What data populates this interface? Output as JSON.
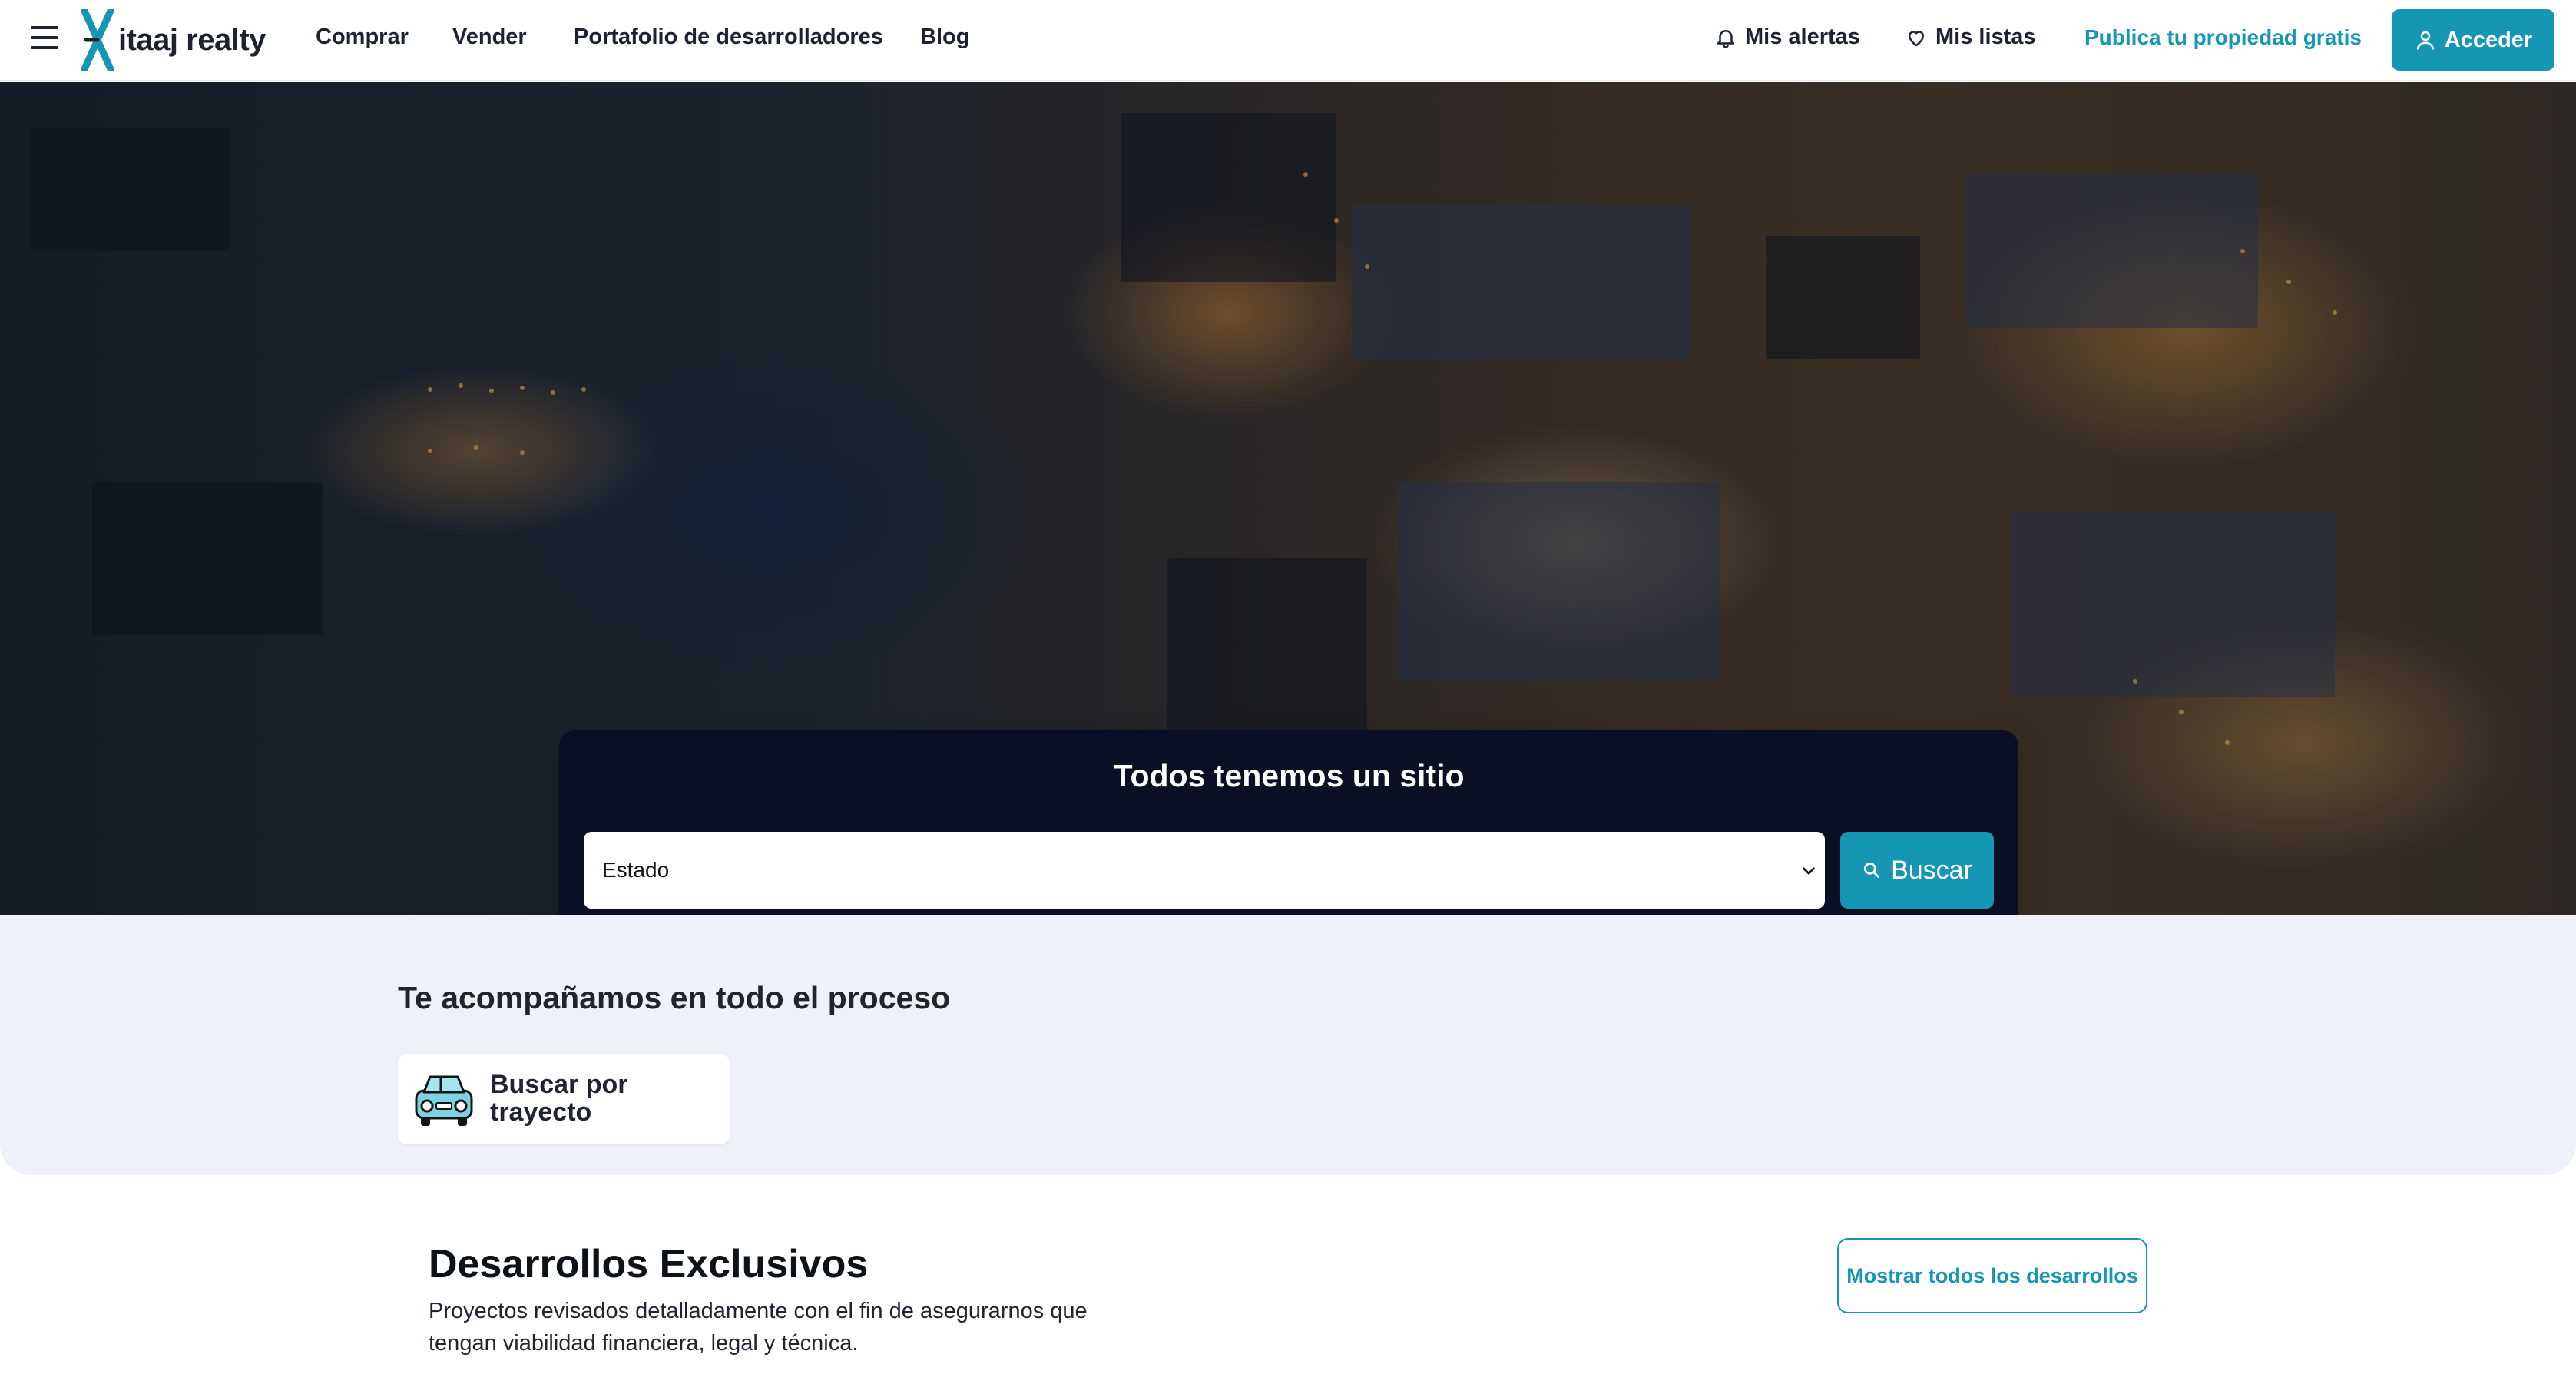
{
  "brand": {
    "name": "itaaj realty",
    "accent_color": "#1596b5",
    "logo_icon": "itaaj-x-logo-icon"
  },
  "nav": {
    "items": [
      "Comprar",
      "Vender",
      "Portafolio de desarrolladores",
      "Blog"
    ],
    "alerts_label": "Mis alertas",
    "lists_label": "Mis listas",
    "publish_label": "Publica tu propiedad gratis",
    "login_label": "Acceder"
  },
  "hero": {
    "image": "aerial night city view with harbor and lit buildings",
    "search_title": "Todos tenemos un sitio",
    "state_select_value": "Estado",
    "search_button_label": "Buscar"
  },
  "process": {
    "title": "Te acompañamos en todo el proceso",
    "cards": [
      {
        "icon": "car-icon",
        "label": "Buscar por trayecto"
      }
    ]
  },
  "developments": {
    "title": "Desarrollos Exclusivos",
    "description": "Proyectos revisados detalladamente con el fin de asegurarnos que tengan viabilidad financiera, legal y técnica.",
    "show_all_label": "Mostrar todos los desarrollos"
  }
}
